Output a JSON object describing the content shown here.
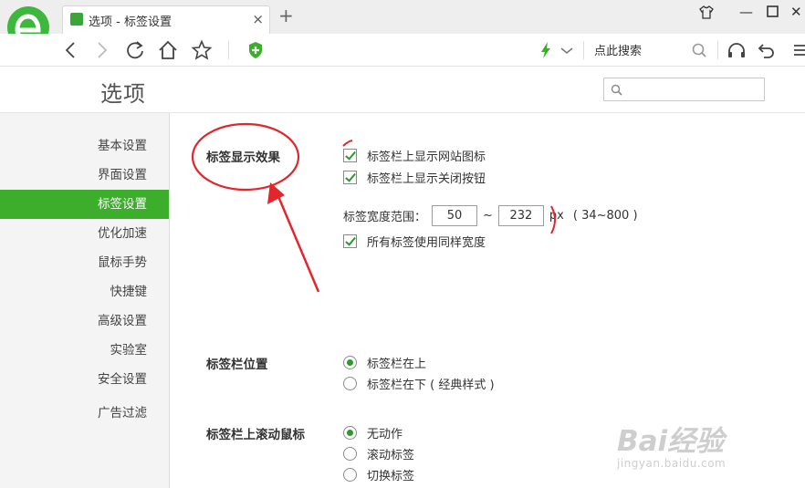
{
  "browser": {
    "tab_title": "选项 - 标签设置",
    "tab_close": "×",
    "new_tab": "+",
    "search_placeholder": "点此搜索",
    "window_controls": {
      "minimize": "—",
      "maximize": "☐",
      "close": "✕"
    },
    "icons": [
      "browser-logo-icon",
      "back-icon",
      "forward-icon",
      "refresh-icon",
      "home-icon",
      "favorite-star-icon",
      "shield-icon",
      "lightning-icon",
      "chevron-down-icon",
      "search-icon",
      "headphones-icon",
      "undo-icon",
      "menu-icon",
      "skin-icon"
    ]
  },
  "page": {
    "title": "选项"
  },
  "sidebar": {
    "items": [
      {
        "label": "基本设置"
      },
      {
        "label": "界面设置"
      },
      {
        "label": "标签设置",
        "active": true
      },
      {
        "label": "优化加速"
      },
      {
        "label": "鼠标手势"
      },
      {
        "label": "快捷键"
      },
      {
        "label": "高级设置"
      },
      {
        "label": "实验室"
      },
      {
        "label": "安全设置"
      },
      {
        "label": "广告过滤"
      }
    ]
  },
  "sections": {
    "tab_display": {
      "title": "标签显示效果",
      "show_site_icon": {
        "label": "标签栏上显示网站图标",
        "checked": true
      },
      "show_close_button": {
        "label": "标签栏上显示关闭按钮",
        "checked": true
      },
      "width_range": {
        "label": "标签宽度范围：",
        "min_value": "50",
        "separator": "~",
        "max_value": "232",
        "unit": "px",
        "hint": "( 34~800 )"
      },
      "same_width": {
        "label": "所有标签使用同样宽度",
        "checked": true
      }
    },
    "tab_position": {
      "title": "标签栏位置",
      "options": [
        {
          "label": "标签栏在上",
          "selected": true
        },
        {
          "label": "标签栏在下 ( 经典样式 )",
          "selected": false
        }
      ]
    },
    "scroll_action": {
      "title": "标签栏上滚动鼠标",
      "options": [
        {
          "label": "无动作",
          "selected": true
        },
        {
          "label": "滚动标签",
          "selected": false
        },
        {
          "label": "切换标签",
          "selected": false
        }
      ]
    }
  },
  "watermark": {
    "brand": "Bai经验",
    "url": "jingyan.baidu.com"
  },
  "colors": {
    "accent_green": "#3cae2b",
    "check_green": "#2d9a2d",
    "annotation_red": "#e3262b",
    "logo_green": "#3db83c"
  }
}
